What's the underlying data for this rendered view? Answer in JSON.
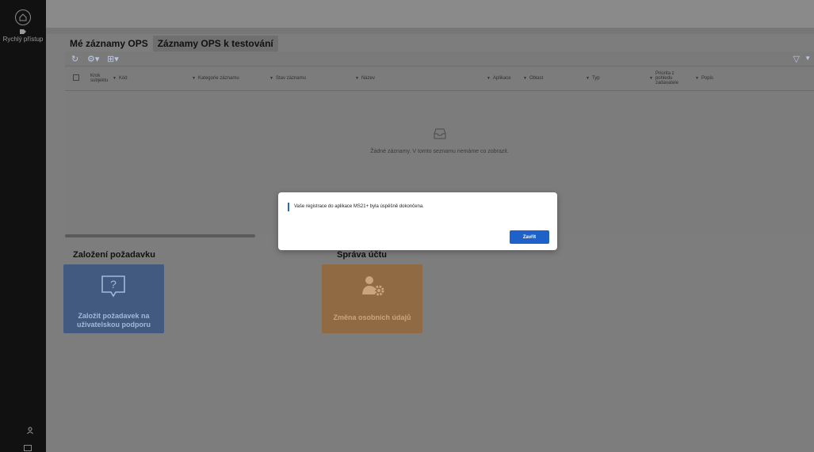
{
  "sidebar": {
    "quick_access": "Rychlý přístup",
    "user_icon": "person-icon"
  },
  "tabs": [
    "Mé záznamy OPS",
    "Záznamy OPS k testování"
  ],
  "table": {
    "columns": [
      "Krok subjektu",
      "Kód",
      "Kategorie záznamu",
      "Stav záznamu",
      "Název",
      "Aplikace",
      "Oblast",
      "Typ",
      "Priorita z pohledu zadavatele",
      "Popis"
    ],
    "empty_message": "Žádné záznamy. V tomto seznamu nemáme co zobrazit."
  },
  "sections": {
    "request_title": "Založení požadavku",
    "account_title": "Správa účtu",
    "request_tile": "Založit požadavek na uživatelskou podporu",
    "account_tile": "Změna osobních údajů"
  },
  "dialog": {
    "message": "Vaše registrace do aplikace MS21+ byla úspěšně dokončena.",
    "close_label": "Zavřít"
  },
  "colors": {
    "accent": "#1d61c9",
    "tile_blue": "#425a7f",
    "tile_orange": "#8f6a43"
  }
}
